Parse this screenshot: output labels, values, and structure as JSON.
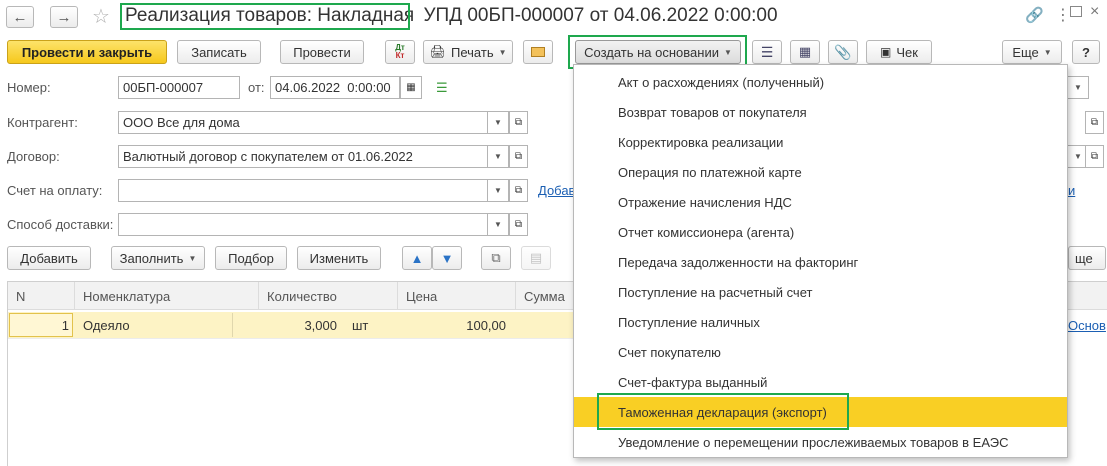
{
  "header": {
    "title_main": "Реализация товаров: Накладная",
    "title_rest": "УПД 00БП-000007 от 04.06.2022 0:00:00"
  },
  "toolbar": {
    "post_close": "Провести и закрыть",
    "save": "Записать",
    "post": "Провести",
    "dt_kt_top": "Дт",
    "dt_kt_bottom": "Кт",
    "print": "Печать",
    "create_based": "Создать на основании",
    "check": "Чек",
    "more": "Еще",
    "help": "?"
  },
  "form": {
    "number_label": "Номер:",
    "number_value": "00БП-000007",
    "date_label": "от:",
    "date_value": "04.06.2022  0:00:00",
    "contractor_label": "Контрагент:",
    "contractor_value": "ООО Все для дома",
    "contract_label": "Договор:",
    "contract_value": "Валютный договор с покупателем от 01.06.2022",
    "invoice_label": "Счет на оплату:",
    "invoice_value": "",
    "delivery_label": "Способ доставки:",
    "delivery_value": "",
    "add_link_partial": "Добав",
    "right_link_partial": "и"
  },
  "table_toolbar": {
    "add": "Добавить",
    "fill": "Заполнить",
    "select": "Подбор",
    "change": "Изменить",
    "more_partial": "ще"
  },
  "table": {
    "columns": [
      "N",
      "Номенклатура",
      "Количество",
      "Цена",
      "Сумма"
    ],
    "rows": [
      {
        "n": "1",
        "item": "Одеяло",
        "qty": "3,000",
        "unit": "шт",
        "price": "100,00"
      }
    ],
    "right_link_partial": "Основ"
  },
  "menu": {
    "items": [
      "Акт о расхождениях (полученный)",
      "Возврат товаров от покупателя",
      "Корректировка реализации",
      "Операция по платежной карте",
      "Отражение начисления НДС",
      "Отчет комиссионера (агента)",
      "Передача задолженности на факторинг",
      "Поступление на расчетный счет",
      "Поступление наличных",
      "Счет покупателю",
      "Счет-фактура выданный",
      "Таможенная декларация (экспорт)",
      "Уведомление о перемещении прослеживаемых товаров в ЕАЭС"
    ],
    "selected": "Таможенная декларация (экспорт)"
  },
  "colors": {
    "accent_yellow": "#f6c81c",
    "highlight_green": "#1ea84e",
    "selected_row": "#fdf3c5",
    "link_blue": "#1b5fb3"
  }
}
